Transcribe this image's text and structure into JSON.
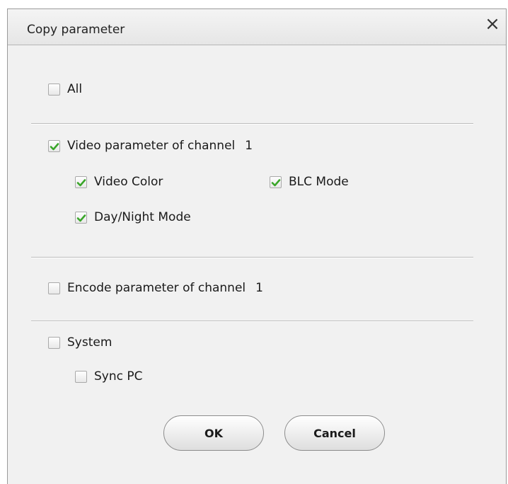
{
  "dialog": {
    "title": "Copy parameter",
    "close_glyph": "×"
  },
  "options": {
    "all": {
      "label": "All",
      "checked": false
    },
    "video": {
      "label": "Video parameter of channel",
      "channel": "1",
      "checked": true,
      "children": {
        "video_color": {
          "label": "Video Color",
          "checked": true
        },
        "blc_mode": {
          "label": "BLC Mode",
          "checked": true
        },
        "day_night_mode": {
          "label": "Day/Night Mode",
          "checked": true
        }
      }
    },
    "encode": {
      "label": "Encode parameter of channel",
      "channel": "1",
      "checked": false
    },
    "system": {
      "label": "System",
      "checked": false,
      "children": {
        "sync_pc": {
          "label": "Sync PC",
          "checked": false
        }
      }
    }
  },
  "buttons": {
    "ok_label": "OK",
    "cancel_label": "Cancel"
  },
  "colors": {
    "check_mark": "#3aa62a"
  },
  "icons": {
    "check": "check-icon",
    "close": "close-icon"
  }
}
